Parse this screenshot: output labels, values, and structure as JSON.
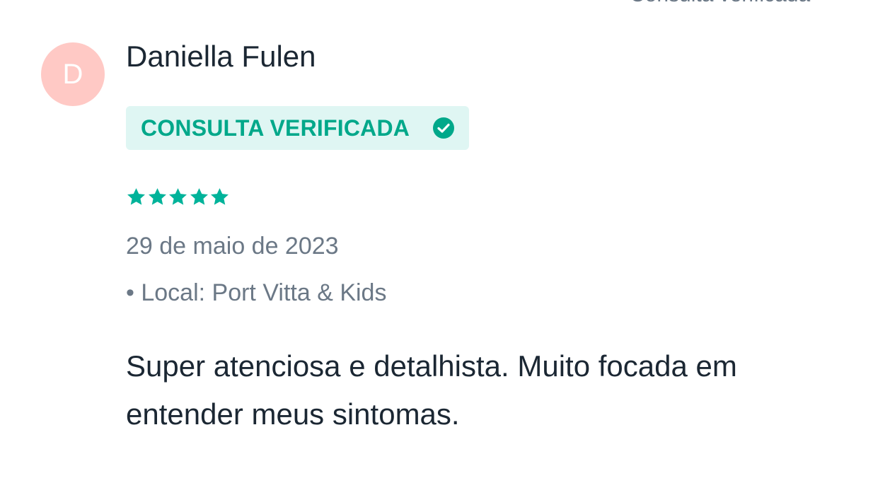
{
  "header": {
    "cutoff_text": "Consulta verificada"
  },
  "review": {
    "avatar_initial": "D",
    "reviewer_name": "Daniella Fulen",
    "verified_label": "CONSULTA VERIFICADA",
    "rating": 5,
    "rating_max": 5,
    "date": "29 de maio de 2023",
    "location": "• Local: Port Vitta & Kids",
    "text": "Super atenciosa e detalhista. Muito focada em entender meus sintomas."
  },
  "colors": {
    "accent": "#00a88a",
    "star": "#00b39a",
    "badge_bg": "#dff6f3",
    "avatar_bg": "#ffc9c5",
    "text_primary": "#1b2733",
    "text_secondary": "#6b7886"
  },
  "icons": {
    "verified": "check-circle-icon",
    "rating": "star-icon"
  }
}
